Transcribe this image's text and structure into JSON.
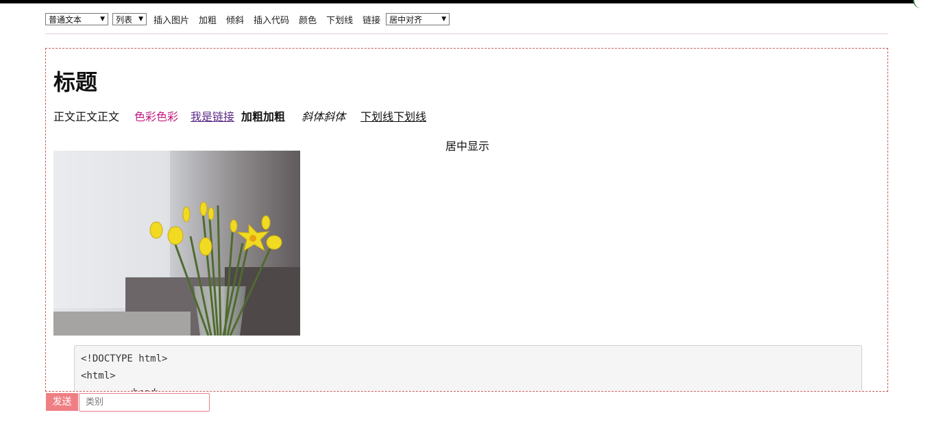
{
  "toolbar": {
    "format_select": "普通文本",
    "list_select": "列表",
    "insert_image": "插入图片",
    "bold": "加粗",
    "italic": "倾斜",
    "insert_code": "插入代码",
    "color": "颜色",
    "underline": "下划线",
    "link": "链接",
    "align_select": "居中对齐"
  },
  "editor": {
    "title": "标题",
    "paragraph": {
      "normal": "正文正文正文",
      "colored": "色彩色彩",
      "link": "我是链接",
      "bold": "加粗加粗",
      "italic": "斜体斜体",
      "underline": "下划线下划线"
    },
    "centered_text": "居中显示",
    "code_lines": [
      "<!DOCTYPE html>",
      "<html>",
      "        <head>"
    ]
  },
  "footer": {
    "send_label": "发送",
    "category_placeholder": "类别"
  },
  "colors": {
    "colored_text": "#c2187e",
    "send_button": "#ef7f84",
    "editor_border": "#c55a5a"
  }
}
